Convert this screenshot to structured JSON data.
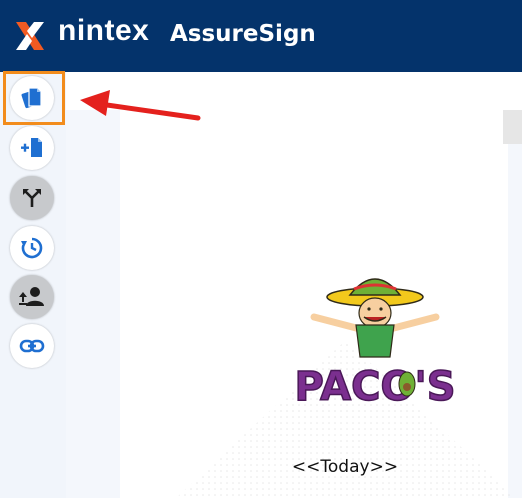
{
  "header": {
    "brand": "nintex",
    "product": "AssureSign",
    "brand_color": "#04336b",
    "accent_color": "#f15a22"
  },
  "sidebar": {
    "items": [
      {
        "icon": "documents-icon",
        "selected": true
      },
      {
        "icon": "add-document-icon",
        "selected": false
      },
      {
        "icon": "branch-icon",
        "selected": false
      },
      {
        "icon": "history-icon",
        "selected": false
      },
      {
        "icon": "upload-user-icon",
        "selected": false
      },
      {
        "icon": "link-icon",
        "selected": false
      }
    ]
  },
  "document": {
    "logo_text": "PACO'S",
    "placeholder": "<<Today>>"
  },
  "annotation": {
    "highlight_color": "#f28c1c",
    "arrow_color": "#e4211d"
  }
}
